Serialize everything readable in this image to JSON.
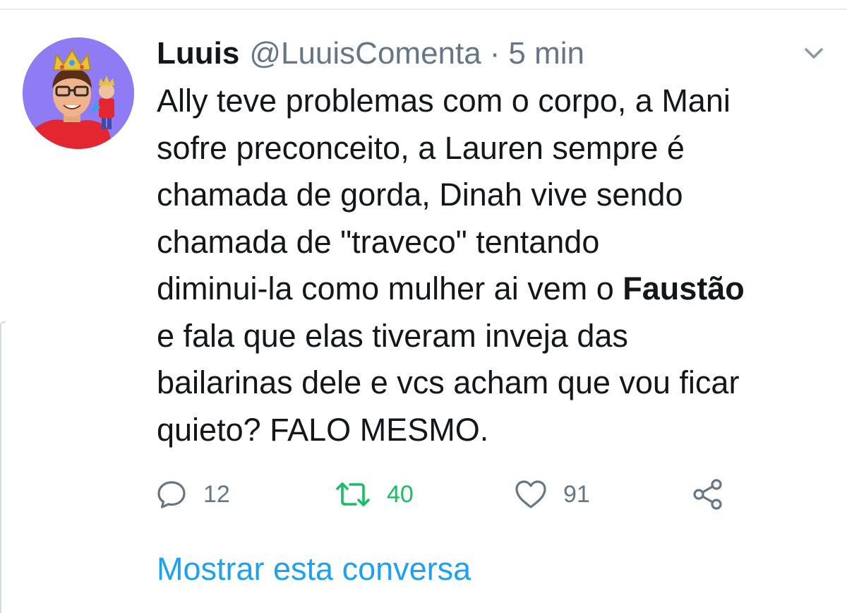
{
  "tweet": {
    "author": {
      "display_name": "Luuis",
      "handle": "@LuuisComenta"
    },
    "separator": "·",
    "time": "5 min",
    "text": {
      "line1": "Ally teve problemas com o corpo, a Mani",
      "line2": "sofre preconceito, a Lauren sempre é",
      "line3": "chamada de gorda, Dinah vive sendo",
      "line4": "chamada de \"traveco\" tentando",
      "line5_before": "diminui-la como mulher ai vem o ",
      "line5_bold": "Faustão",
      "line6": "e fala que elas tiveram inveja das",
      "line7": "bailarinas dele e vcs acham que vou ficar",
      "line8": "quieto? FALO MESMO."
    },
    "actions": {
      "reply_count": "12",
      "retweet_count": "40",
      "like_count": "91"
    },
    "show_thread_label": "Mostrar esta conversa"
  },
  "icons": {
    "menu": "chevron-down-icon",
    "reply": "reply-icon",
    "retweet": "retweet-icon",
    "like": "heart-icon",
    "share": "share-icon"
  },
  "colors": {
    "text": "#14171a",
    "secondary": "#657786",
    "link": "#1da1f2",
    "retweet_active": "#17bf63",
    "divider": "#e6ecf0"
  }
}
